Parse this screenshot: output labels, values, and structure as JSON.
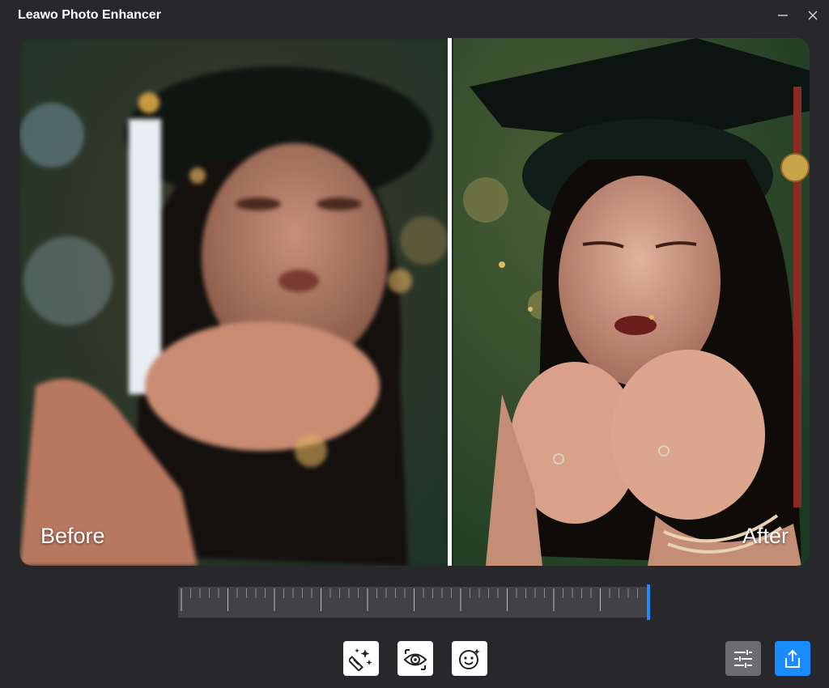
{
  "app": {
    "title": "Leawo Photo Enhancer"
  },
  "window_controls": {
    "minimize_icon": "minimize-icon",
    "close_icon": "close-icon"
  },
  "viewer": {
    "before_label": "Before",
    "after_label": "After",
    "divider_position_percent": 54
  },
  "slider": {
    "value_percent": 100,
    "tick_count": 50,
    "accent": "#1e8bff"
  },
  "toolbar": {
    "tools": [
      {
        "name": "magic-wand-icon"
      },
      {
        "name": "eye-icon"
      },
      {
        "name": "face-icon"
      }
    ],
    "settings_icon": "sliders-icon",
    "export_icon": "share-icon"
  },
  "colors": {
    "background": "#28282c",
    "export_button": "#1a8cff",
    "settings_button": "#6b6b70"
  }
}
